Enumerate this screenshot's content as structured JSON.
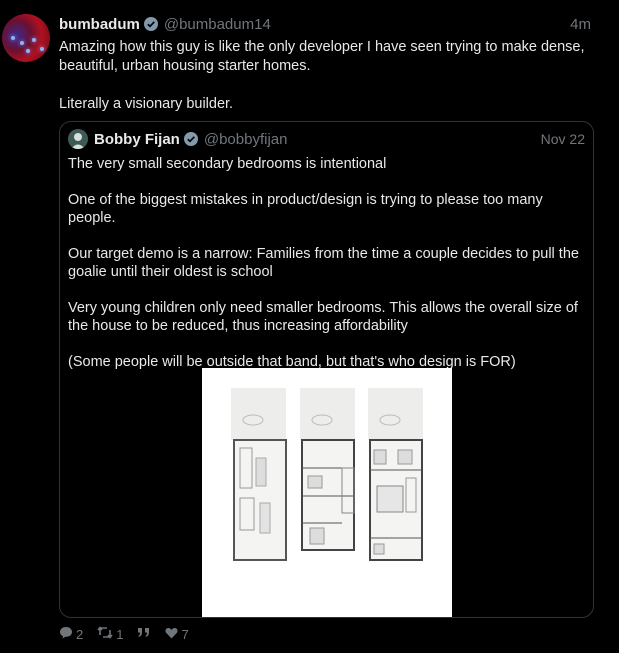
{
  "tweet": {
    "author_name": "bumbadum",
    "author_handle": "@bumbadum14",
    "time": "4m",
    "paragraphs": [
      "Amazing how this guy is like the only developer I have seen trying to make dense, beautiful, urban housing starter homes.",
      "Literally a visionary builder."
    ]
  },
  "quote": {
    "author_name": "Bobby Fijan",
    "author_handle": "@bobbyfijan",
    "time": "Nov 22",
    "paragraphs": [
      "The very small secondary bedrooms is intentional",
      "One of the biggest mistakes in product/design is trying to please too many people.",
      "Our target demo is a narrow: Families from the time a couple decides to pull the goalie until their oldest is school",
      "Very young children only need smaller bedrooms. This allows the overall size of the house to be reduced, thus increasing affordability",
      "(Some people will be outside that band, but that's who design is FOR)"
    ]
  },
  "actions": {
    "replies": "2",
    "retweets": "1",
    "likes": "7"
  },
  "colors": {
    "background": "#000000",
    "verified": "#829aab",
    "muted": "#71767b"
  }
}
